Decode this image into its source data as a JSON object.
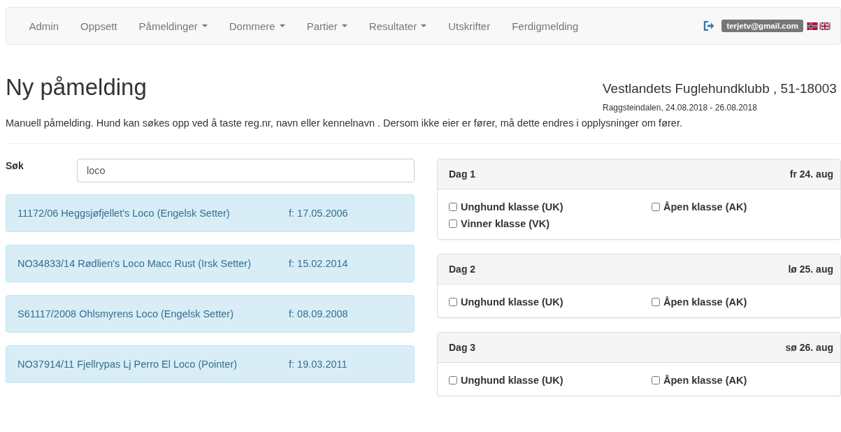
{
  "navbar": {
    "items": [
      {
        "label": "Admin",
        "dropdown": false
      },
      {
        "label": "Oppsett",
        "dropdown": false
      },
      {
        "label": "Påmeldinger",
        "dropdown": true
      },
      {
        "label": "Dommere",
        "dropdown": true
      },
      {
        "label": "Partier",
        "dropdown": true
      },
      {
        "label": "Resultater",
        "dropdown": true
      },
      {
        "label": "Utskrifter",
        "dropdown": false
      },
      {
        "label": "Ferdigmelding",
        "dropdown": false
      }
    ],
    "user": "terjetv@gmail.com"
  },
  "page": {
    "title": "Ny påmelding",
    "club": "Vestlandets Fuglehundklubb , 51-18003",
    "venue": "Raggsteindalen, 24.08.2018 - 26.08.2018",
    "description": "Manuell påmelding. Hund kan søkes opp ved å taste reg.nr, navn eller kennelnavn . Dersom ikke eier er fører, må dette endres i opplysninger om fører."
  },
  "search": {
    "label": "Søk",
    "value": "loco"
  },
  "results": [
    {
      "dog": "11172/06 Heggsjøfjellet's Loco (Engelsk Setter)",
      "born": "f: 17.05.2006"
    },
    {
      "dog": "NO34833/14 Rødlien's Loco Macc Rust (Irsk Setter)",
      "born": "f: 15.02.2014"
    },
    {
      "dog": "S61117/2008 Ohlsmyrens Loco (Engelsk Setter)",
      "born": "f: 08.09.2008"
    },
    {
      "dog": "NO37914/11 Fjellrypas Lj Perro El Loco (Pointer)",
      "born": "f: 19.03.2011"
    }
  ],
  "days": [
    {
      "title": "Dag 1",
      "date": "fr 24. aug",
      "classes": [
        {
          "label": "Unghund klasse (UK)",
          "checked": false
        },
        {
          "label": "Åpen klasse (AK)",
          "checked": false
        },
        {
          "label": "Vinner klasse (VK)",
          "checked": false
        }
      ]
    },
    {
      "title": "Dag 2",
      "date": "lø 25. aug",
      "classes": [
        {
          "label": "Unghund klasse (UK)",
          "checked": false
        },
        {
          "label": "Åpen klasse (AK)",
          "checked": false
        }
      ]
    },
    {
      "title": "Dag 3",
      "date": "sø 26. aug",
      "classes": [
        {
          "label": "Unghund klasse (UK)",
          "checked": false
        },
        {
          "label": "Åpen klasse (AK)",
          "checked": false
        }
      ]
    }
  ]
}
